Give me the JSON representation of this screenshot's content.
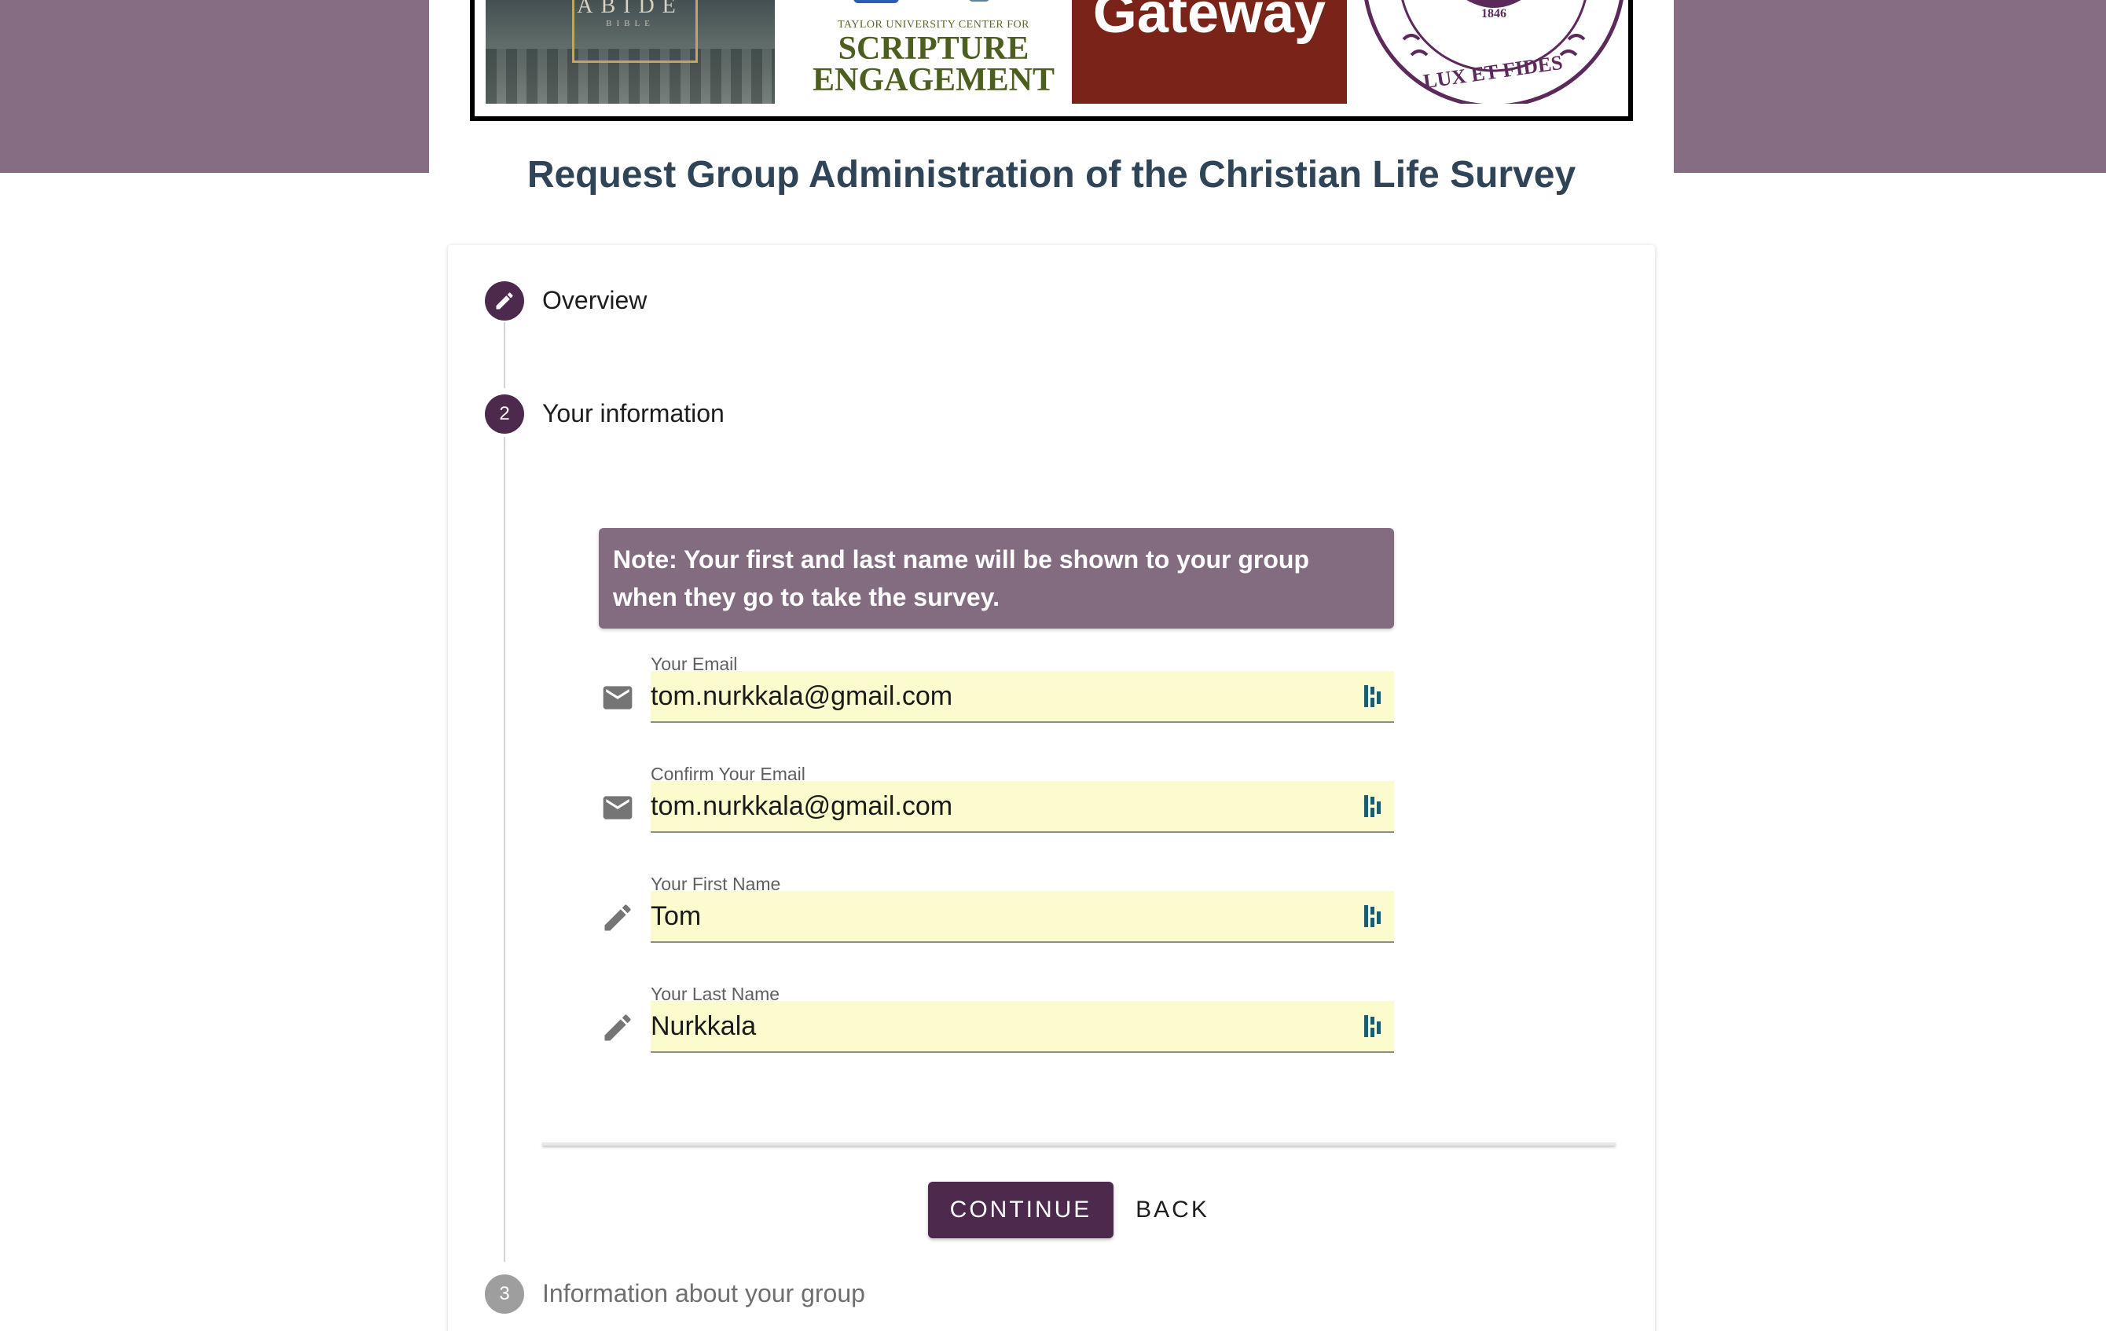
{
  "banner": {
    "logo1": {
      "title": "ABIDE",
      "subtitle": "BIBLE"
    },
    "logo2": {
      "small": "TAYLOR UNIVERSITY CENTER FOR",
      "line1": "SCRIPTURE",
      "line2": "ENGAGEMENT"
    },
    "logo3": {
      "text": "Gateway"
    },
    "logo4": {
      "year": "1846",
      "motto": "LUX ET FIDES"
    }
  },
  "page_title": "Request Group Administration of the Christian Life Survey",
  "steps": [
    {
      "number": "",
      "label": "Overview",
      "state": "edit",
      "icon": "pencil-icon"
    },
    {
      "number": "2",
      "label": "Your information",
      "state": "active"
    },
    {
      "number": "3",
      "label": "Information about your group",
      "state": "inactive"
    }
  ],
  "note": "Note: Your first and last name will be shown to your group when they go to take the survey.",
  "fields": {
    "email": {
      "label": "Your Email",
      "value": "tom.nurkkala@gmail.com",
      "icon": "mail-icon"
    },
    "confirm_email": {
      "label": "Confirm Your Email",
      "value": "tom.nurkkala@gmail.com",
      "icon": "mail-icon"
    },
    "first_name": {
      "label": "Your First Name",
      "value": "Tom",
      "icon": "pencil-icon"
    },
    "last_name": {
      "label": "Your Last Name",
      "value": "Nurkkala",
      "icon": "pencil-icon"
    }
  },
  "buttons": {
    "continue": "CONTINUE",
    "back": "BACK"
  },
  "colors": {
    "brand": "#4d2a4d",
    "band": "#866d84",
    "note_bg": "#836c80",
    "autofill": "#fbfbcd",
    "title": "#2f4457"
  }
}
